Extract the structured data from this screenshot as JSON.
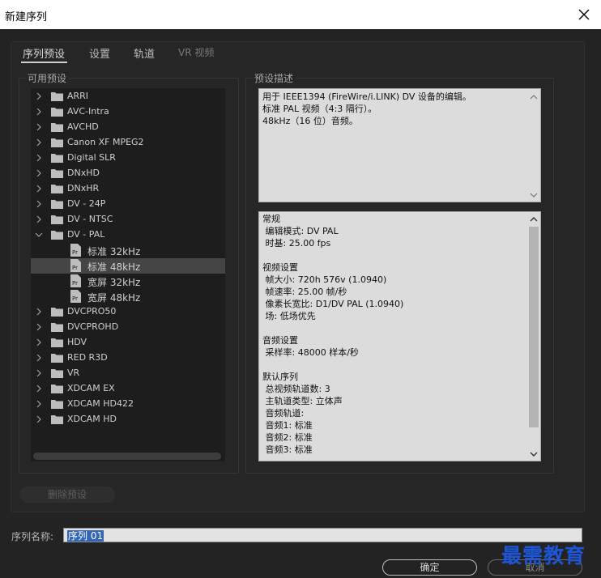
{
  "window": {
    "title": "新建序列"
  },
  "tabs": [
    {
      "label": "序列预设",
      "active": true
    },
    {
      "label": "设置",
      "active": false
    },
    {
      "label": "轨道",
      "active": false
    },
    {
      "label": "VR 视频",
      "active": false,
      "disabled": true
    }
  ],
  "presets": {
    "label": "可用预设",
    "items": [
      {
        "label": "ARRI",
        "type": "folder",
        "expanded": false
      },
      {
        "label": "AVC-Intra",
        "type": "folder",
        "expanded": false
      },
      {
        "label": "AVCHD",
        "type": "folder",
        "expanded": false
      },
      {
        "label": "Canon XF MPEG2",
        "type": "folder",
        "expanded": false
      },
      {
        "label": "Digital SLR",
        "type": "folder",
        "expanded": false
      },
      {
        "label": "DNxHD",
        "type": "folder",
        "expanded": false
      },
      {
        "label": "DNxHR",
        "type": "folder",
        "expanded": false
      },
      {
        "label": "DV - 24P",
        "type": "folder",
        "expanded": false
      },
      {
        "label": "DV - NTSC",
        "type": "folder",
        "expanded": false
      },
      {
        "label": "DV - PAL",
        "type": "folder",
        "expanded": true
      },
      {
        "label": "标准 32kHz",
        "type": "preset",
        "selected": false
      },
      {
        "label": "标准 48kHz",
        "type": "preset",
        "selected": true
      },
      {
        "label": "宽屏 32kHz",
        "type": "preset",
        "selected": false
      },
      {
        "label": "宽屏 48kHz",
        "type": "preset",
        "selected": false
      },
      {
        "label": "DVCPRO50",
        "type": "folder",
        "expanded": false
      },
      {
        "label": "DVCPROHD",
        "type": "folder",
        "expanded": false
      },
      {
        "label": "HDV",
        "type": "folder",
        "expanded": false
      },
      {
        "label": "RED R3D",
        "type": "folder",
        "expanded": false
      },
      {
        "label": "VR",
        "type": "folder",
        "expanded": false
      },
      {
        "label": "XDCAM EX",
        "type": "folder",
        "expanded": false
      },
      {
        "label": "XDCAM HD422",
        "type": "folder",
        "expanded": false
      },
      {
        "label": "XDCAM HD",
        "type": "folder",
        "expanded": false
      }
    ]
  },
  "description": {
    "label": "预设描述",
    "text_lines": [
      "用于 IEEE1394 (FireWire/i.LINK) DV 设备的编辑。",
      "标准 PAL 视频（4:3 隔行）。",
      "48kHz（16 位）音频。"
    ],
    "detail_lines": [
      "常规",
      " 编辑模式: DV PAL",
      " 时基: 25.00 fps",
      "",
      "视频设置",
      " 帧大小: 720h 576v (1.0940)",
      " 帧速率: 25.00 帧/秒",
      " 像素长宽比: D1/DV PAL (1.0940)",
      " 场: 低场优先",
      "",
      "音频设置",
      " 采样率: 48000 样本/秒",
      "",
      "默认序列",
      " 总视频轨道数: 3",
      " 主轨道类型: 立体声",
      " 音频轨道:",
      " 音频1: 标准",
      " 音频2: 标准",
      " 音频3: 标准"
    ]
  },
  "buttons": {
    "delete": "删除预设",
    "ok": "确定",
    "cancel": "取消"
  },
  "sequence_name": {
    "label": "序列名称:",
    "value": "序列 01"
  },
  "watermark": "最需教育"
}
